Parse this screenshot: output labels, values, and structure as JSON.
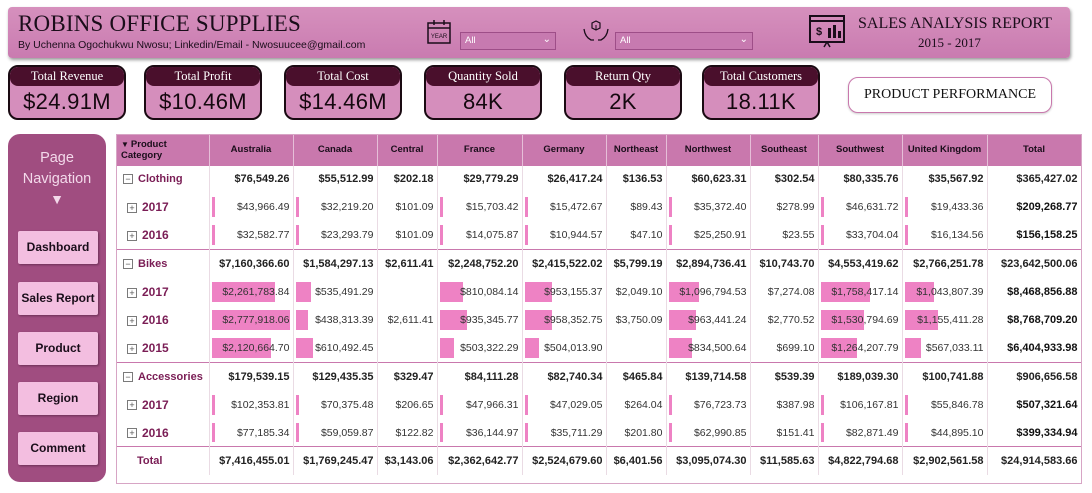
{
  "header": {
    "title": "ROBINS OFFICE SUPPLIES",
    "author": "By Uchenna Ogochukwu Nwosu; Linkedin/Email - Nwosuucee@gmail.com",
    "year_icon_label": "YEAR",
    "slicer_year": "All",
    "slicer_product": "All",
    "report_title": "SALES ANALYSIS REPORT",
    "report_years": "2015 - 2017"
  },
  "kpis": [
    {
      "label": "Total Revenue",
      "value": "$24.91M"
    },
    {
      "label": "Total Profit",
      "value": "$10.46M"
    },
    {
      "label": "Total Cost",
      "value": "$14.46M"
    },
    {
      "label": "Quantity Sold",
      "value": "84K"
    },
    {
      "label": "Return Qty",
      "value": "2K"
    },
    {
      "label": "Total Customers",
      "value": "18.11K"
    }
  ],
  "page_heading": "PRODUCT PERFORMANCE",
  "nav": {
    "title_line1": "Page",
    "title_line2": "Navigation",
    "arrow": "▼",
    "buttons": [
      "Dashboard",
      "Sales Report",
      "Product",
      "Region",
      "Comment"
    ]
  },
  "matrix": {
    "sort_glyph": "▼",
    "columns": [
      "Product Category",
      "Australia",
      "Canada",
      "Central",
      "France",
      "Germany",
      "Northeast",
      "Northwest",
      "Southeast",
      "Southwest",
      "United Kingdom",
      "Total"
    ],
    "rows": [
      {
        "level": 1,
        "toggle": "−",
        "label": "Clothing",
        "cells": [
          "$76,549.26",
          "$55,512.99",
          "$202.18",
          "$29,779.29",
          "$26,417.24",
          "$136.53",
          "$60,623.31",
          "$302.54",
          "$80,335.76",
          "$35,567.92",
          "$365,427.02"
        ],
        "bars": [
          0,
          0,
          0,
          0,
          0,
          0,
          0,
          0,
          0,
          0
        ]
      },
      {
        "level": 2,
        "toggle": "+",
        "label": "2017",
        "cells": [
          "$43,966.49",
          "$32,219.20",
          "$101.09",
          "$15,703.42",
          "$15,472.67",
          "$89.43",
          "$35,372.40",
          "$278.99",
          "$46,631.72",
          "$19,433.36",
          "$209,268.77"
        ],
        "bars": [
          0.016,
          0.012,
          0,
          0.006,
          0.006,
          0,
          0.013,
          0,
          0.017,
          0.007
        ]
      },
      {
        "level": 2,
        "toggle": "+",
        "label": "2016",
        "cells": [
          "$32,582.77",
          "$23,293.79",
          "$101.09",
          "$14,075.87",
          "$10,944.57",
          "$47.10",
          "$25,250.91",
          "$23.55",
          "$33,704.04",
          "$16,134.56",
          "$156,158.25"
        ],
        "bars": [
          0.012,
          0.008,
          0,
          0.005,
          0.004,
          0,
          0.009,
          0,
          0.012,
          0.006
        ]
      },
      {
        "level": 1,
        "toggle": "−",
        "label": "Bikes",
        "cells": [
          "$7,160,366.60",
          "$1,584,297.13",
          "$2,611.41",
          "$2,248,752.20",
          "$2,415,522.02",
          "$5,799.19",
          "$2,894,736.41",
          "$10,743.70",
          "$4,553,419.62",
          "$2,766,251.78",
          "$23,642,500.06"
        ],
        "bars": [
          0,
          0,
          0,
          0,
          0,
          0,
          0,
          0,
          0,
          0
        ]
      },
      {
        "level": 2,
        "toggle": "+",
        "label": "2017",
        "cells": [
          "$2,261,783.84",
          "$535,491.29",
          "",
          "$810,084.14",
          "$953,155.37",
          "$2,049.10",
          "$1,096,794.53",
          "$7,274.08",
          "$1,758,417.14",
          "$1,043,807.39",
          "$8,468,856.88"
        ],
        "bars": [
          0.81,
          0.19,
          0,
          0.29,
          0.34,
          0,
          0.39,
          0,
          0.63,
          0.37
        ]
      },
      {
        "level": 2,
        "toggle": "+",
        "label": "2016",
        "cells": [
          "$2,777,918.06",
          "$438,313.39",
          "$2,611.41",
          "$935,345.77",
          "$958,352.75",
          "$3,750.09",
          "$963,441.24",
          "$2,770.52",
          "$1,530,794.69",
          "$1,155,411.28",
          "$8,768,709.20"
        ],
        "bars": [
          1.0,
          0.16,
          0,
          0.34,
          0.34,
          0,
          0.35,
          0,
          0.55,
          0.42
        ]
      },
      {
        "level": 2,
        "toggle": "+",
        "label": "2015",
        "cells": [
          "$2,120,664.70",
          "$610,492.45",
          "",
          "$503,322.29",
          "$504,013.90",
          "",
          "$834,500.64",
          "$699.10",
          "$1,264,207.79",
          "$567,033.11",
          "$6,404,933.98"
        ],
        "bars": [
          0.76,
          0.22,
          0,
          0.18,
          0.18,
          0,
          0.3,
          0,
          0.46,
          0.2
        ]
      },
      {
        "level": 1,
        "toggle": "−",
        "label": "Accessories",
        "cells": [
          "$179,539.15",
          "$129,435.35",
          "$329.47",
          "$84,111.28",
          "$82,740.34",
          "$465.84",
          "$139,714.58",
          "$539.39",
          "$189,039.30",
          "$100,741.88",
          "$906,656.58"
        ],
        "bars": [
          0,
          0,
          0,
          0,
          0,
          0,
          0,
          0,
          0,
          0
        ]
      },
      {
        "level": 2,
        "toggle": "+",
        "label": "2017",
        "cells": [
          "$102,353.81",
          "$70,375.48",
          "$206.65",
          "$47,966.31",
          "$47,029.05",
          "$264.04",
          "$76,723.73",
          "$387.98",
          "$106,167.81",
          "$55,846.78",
          "$507,321.64"
        ],
        "bars": [
          0.037,
          0.025,
          0,
          0.017,
          0.017,
          0,
          0.028,
          0,
          0.038,
          0.02
        ]
      },
      {
        "level": 2,
        "toggle": "+",
        "label": "2016",
        "cells": [
          "$77,185.34",
          "$59,059.87",
          "$122.82",
          "$36,144.97",
          "$35,711.29",
          "$201.80",
          "$62,990.85",
          "$151.41",
          "$82,871.49",
          "$44,895.10",
          "$399,334.94"
        ],
        "bars": [
          0.028,
          0.021,
          0,
          0.013,
          0.013,
          0,
          0.023,
          0,
          0.03,
          0.016
        ]
      }
    ],
    "total_row": {
      "label": "Total",
      "cells": [
        "$7,416,455.01",
        "$1,769,245.47",
        "$3,143.06",
        "$2,362,642.77",
        "$2,524,679.60",
        "$6,401.56",
        "$3,095,074.30",
        "$11,585.63",
        "$4,822,794.68",
        "$2,902,561.58",
        "$24,914,583.66"
      ]
    }
  },
  "colors": {
    "header_bg": "#c97bb0",
    "kpi_label_bg": "#4a0f2c",
    "kpi_bg": "#d58ebc",
    "nav_bg": "#a04d80",
    "nav_button_bg": "#f3bee0",
    "databar": "#ee82c4",
    "table_header_bg": "#c978ad"
  }
}
